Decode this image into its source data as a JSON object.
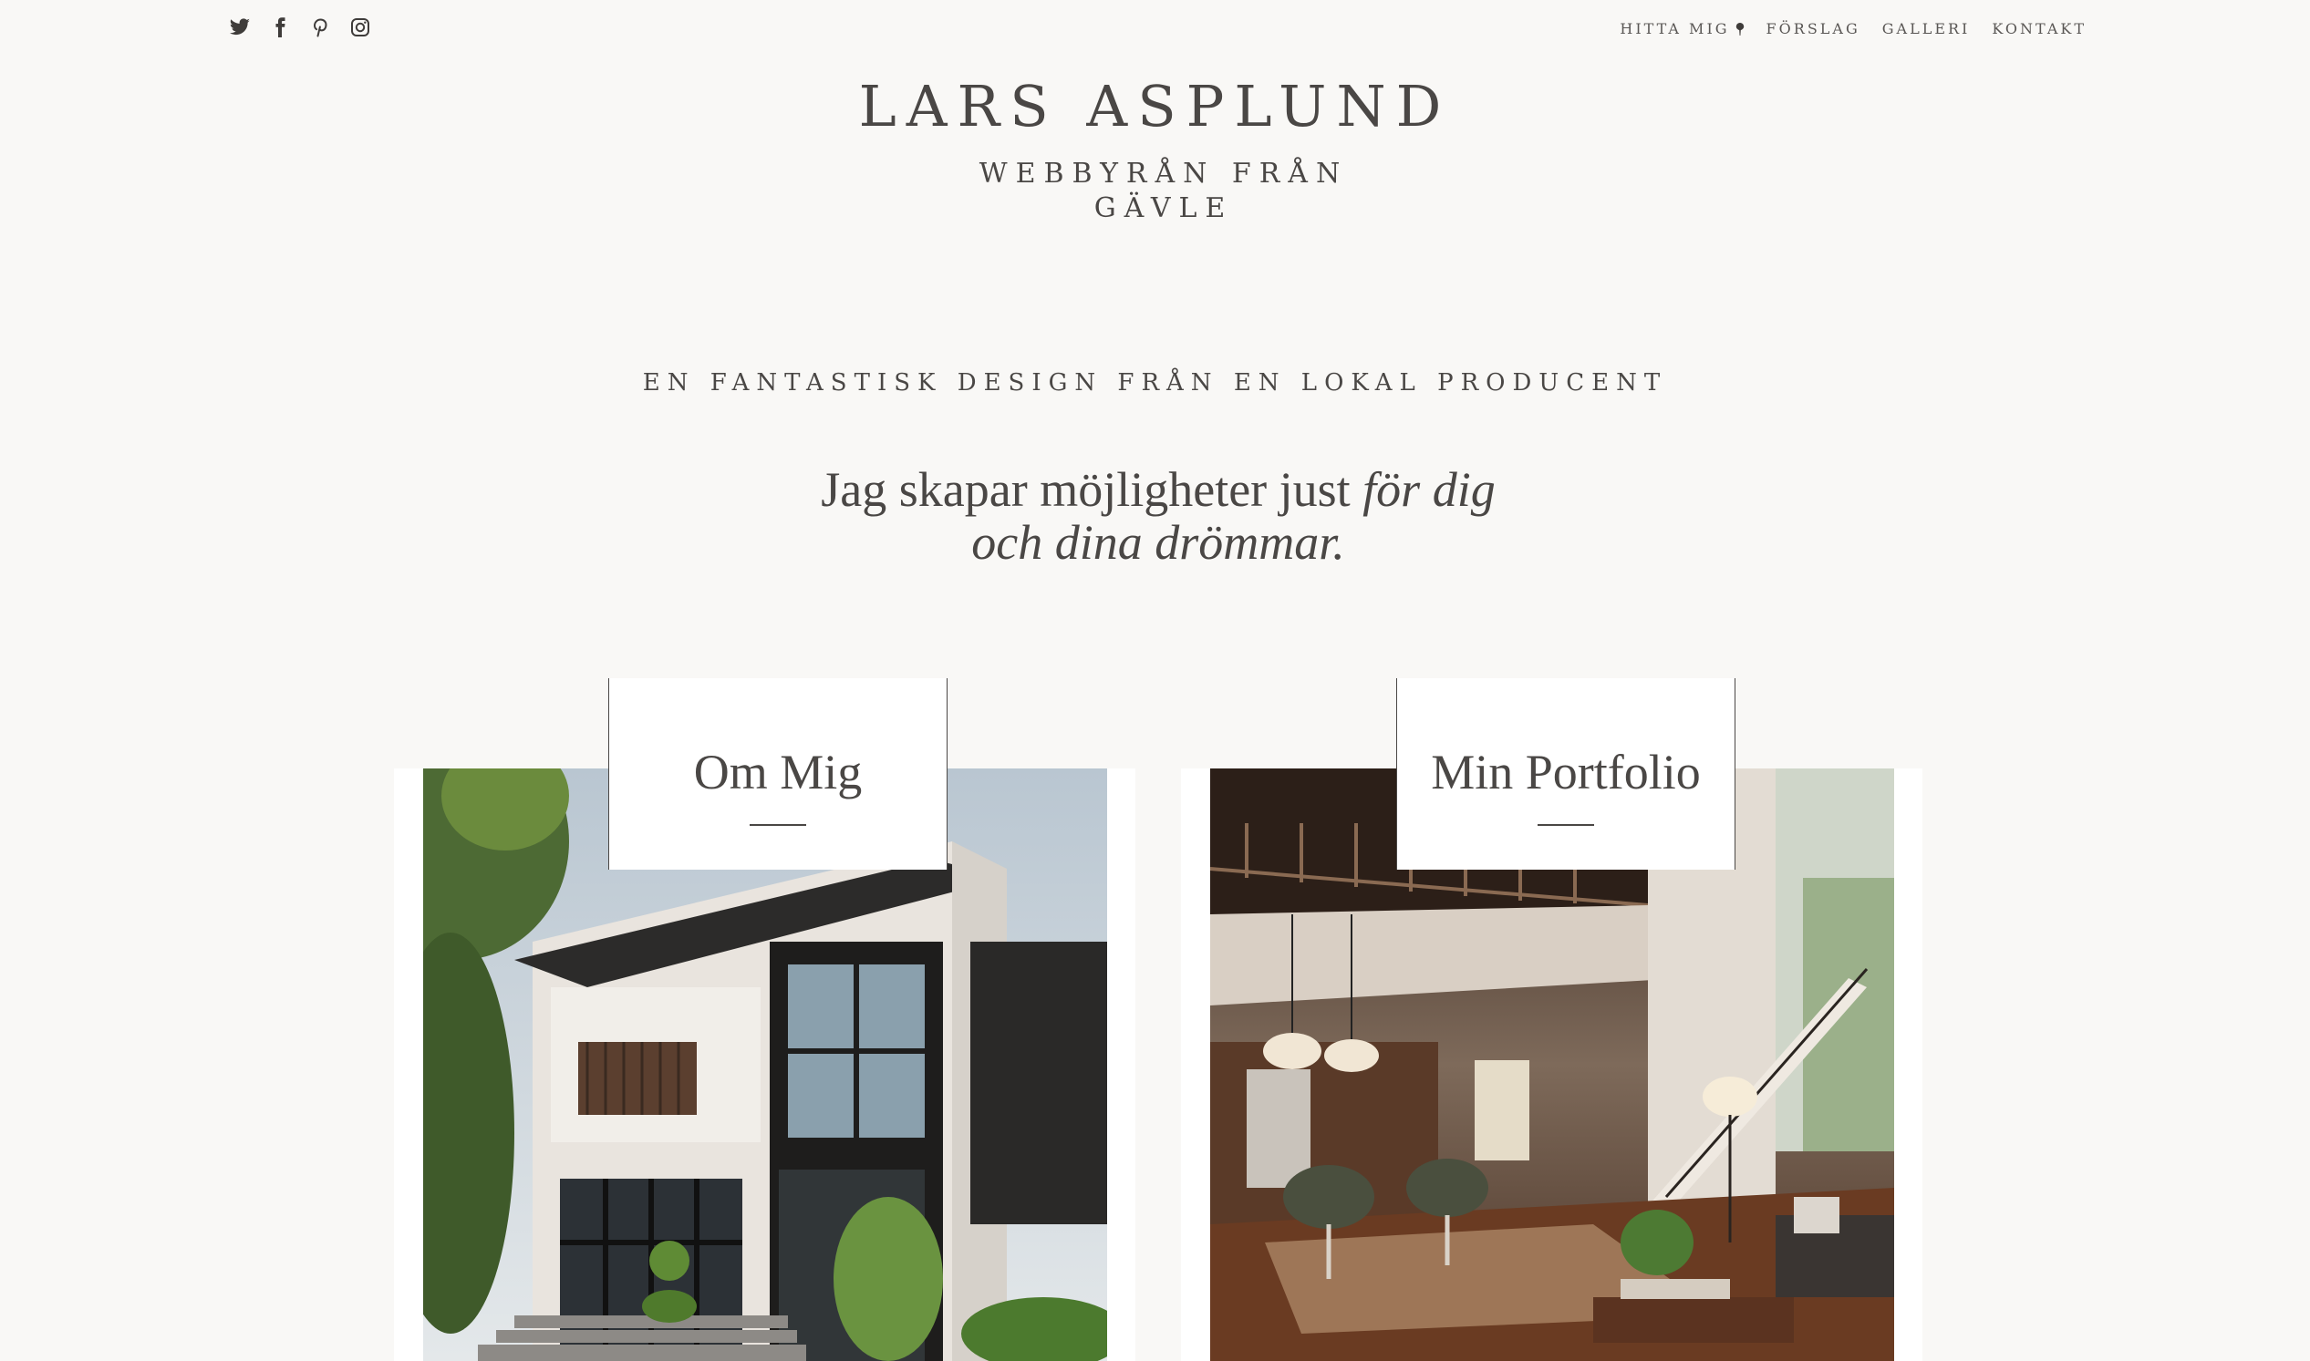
{
  "social": {
    "items": [
      {
        "icon": "twitter-icon"
      },
      {
        "icon": "facebook-icon"
      },
      {
        "icon": "pinterest-icon"
      },
      {
        "icon": "instagram-icon"
      }
    ]
  },
  "nav": {
    "items": [
      {
        "label": "HITTA MIG"
      },
      {
        "label": "FÖRSLAG"
      },
      {
        "label": "GALLERI"
      },
      {
        "label": "KONTAKT"
      }
    ]
  },
  "header": {
    "title": "LARS ASPLUND",
    "subtitle_line1": "WEBBYRÅN FRÅN",
    "subtitle_line2": "GÄVLE"
  },
  "intro": {
    "tagline": "EN FANTASTISK DESIGN FRÅN EN LOKAL PRODUCENT",
    "hero_plain": "Jag skapar möjligheter just ",
    "hero_italic": "för dig och dina drömmar."
  },
  "cards": [
    {
      "label": "Om Mig"
    },
    {
      "label": "Min Portfolio"
    }
  ],
  "colors": {
    "background": "#f9f8f6",
    "text": "#4a4745",
    "card": "#ffffff"
  }
}
